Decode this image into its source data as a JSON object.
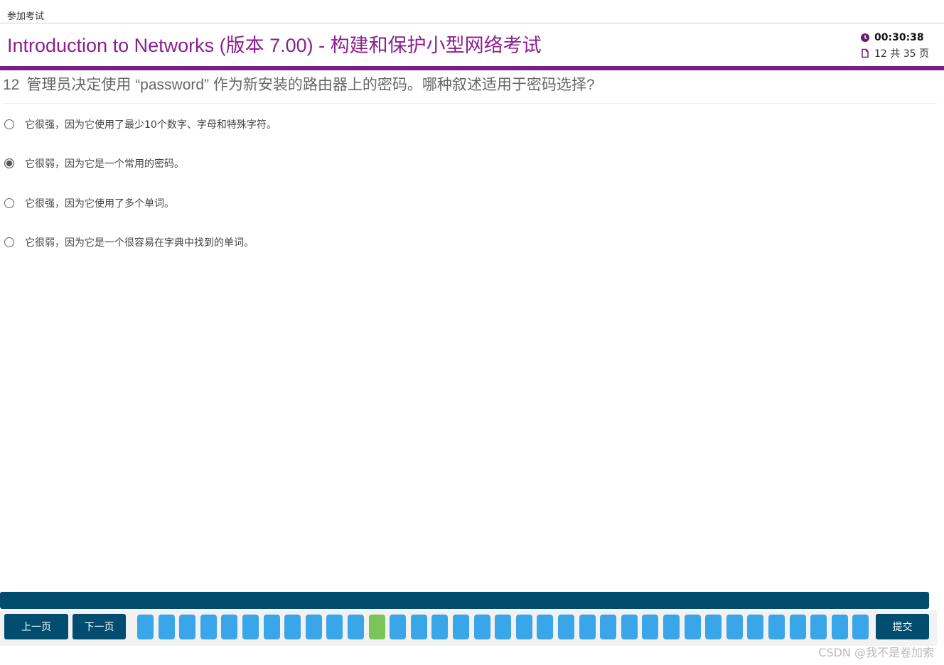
{
  "breadcrumb": "参加考试",
  "header": {
    "title": "Introduction to Networks (版本 7.00) - 构建和保护小型网络考试",
    "timer": "00:30:38",
    "page_info": "12 共 35 页"
  },
  "question": {
    "number": "12",
    "text": "管理员决定使用 “password” 作为新安装的路由器上的密码。哪种叙述适用于密码选择?"
  },
  "options": [
    {
      "label": "它很强，因为它使用了最少10个数字、字母和特殊字符。",
      "selected": false
    },
    {
      "label": "它很弱，因为它是一个常用的密码。",
      "selected": true
    },
    {
      "label": "它很强，因为它使用了多个单词。",
      "selected": false
    },
    {
      "label": "它很弱，因为它是一个很容易在字典中找到的单词。",
      "selected": false
    }
  ],
  "footer": {
    "prev_label": "上一页",
    "next_label": "下一页",
    "submit_label": "提交",
    "question_count": 35,
    "current_question": 12
  },
  "colors": {
    "brand_purple": "#8b1f8f",
    "nav_blue": "#004d6f",
    "question_box": "#3aa6ea",
    "current_box": "#7ac45a"
  },
  "watermark": "CSDN @我不是卷加索"
}
